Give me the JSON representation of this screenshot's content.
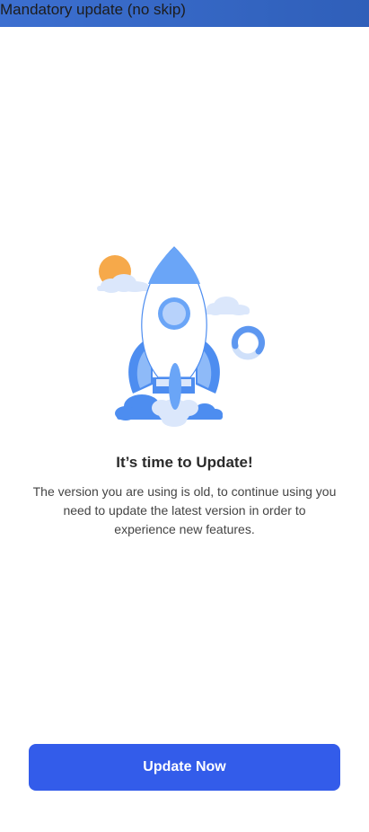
{
  "top_bar": {
    "title": "Mandatory update (no skip)",
    "color": "#3568c8"
  },
  "illustration": {
    "icon": "rocket-icon",
    "accent_color": "#6aa5f7",
    "sun_color": "#f6a94a"
  },
  "content": {
    "heading": "It’s time to Update!",
    "description": "The version you are using is old, to continue using you need to update the latest version in order to experience new features."
  },
  "actions": {
    "update_label": "Update Now",
    "button_color": "#335cea"
  }
}
